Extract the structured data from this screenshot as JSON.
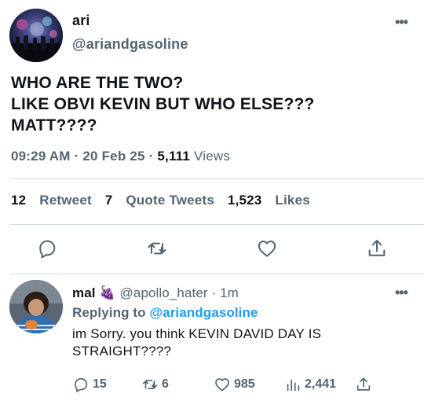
{
  "tweet": {
    "display_name": "ari",
    "handle": "@ariandgasoline",
    "text": "WHO ARE THE TWO?\nLIKE OBVI KEVIN BUT WHO ELSE???\nMATT????",
    "time": "09:29 AM",
    "date": "20 Feb 25",
    "views_count": "5,111",
    "views_label": "Views",
    "retweets_count": "12",
    "retweets_label": "Retweet",
    "quotes_count": "7",
    "quotes_label": "Quote Tweets",
    "likes_count": "1,523",
    "likes_label": "Likes",
    "more_label": "•••"
  },
  "reply": {
    "display_name": "mal",
    "emoji": "🍇",
    "handle": "@apollo_hater",
    "time": "1m",
    "replying_prefix": "Replying to",
    "replying_handle": "@ariandgasoline",
    "text": "im Sorry. you think KEVIN DAVID DAY IS\nSTRAIGHT????",
    "replies": "15",
    "retweets": "6",
    "likes": "985",
    "views": "2,441",
    "more_label": "•••"
  },
  "icons": {
    "reply": "reply-icon",
    "retweet": "retweet-icon",
    "like": "heart-icon",
    "share": "share-icon",
    "views": "views-icon"
  },
  "colors": {
    "text": "#0f1419",
    "secondary": "#536471",
    "link": "#1d9bf0",
    "divider": "#cfd9de"
  }
}
